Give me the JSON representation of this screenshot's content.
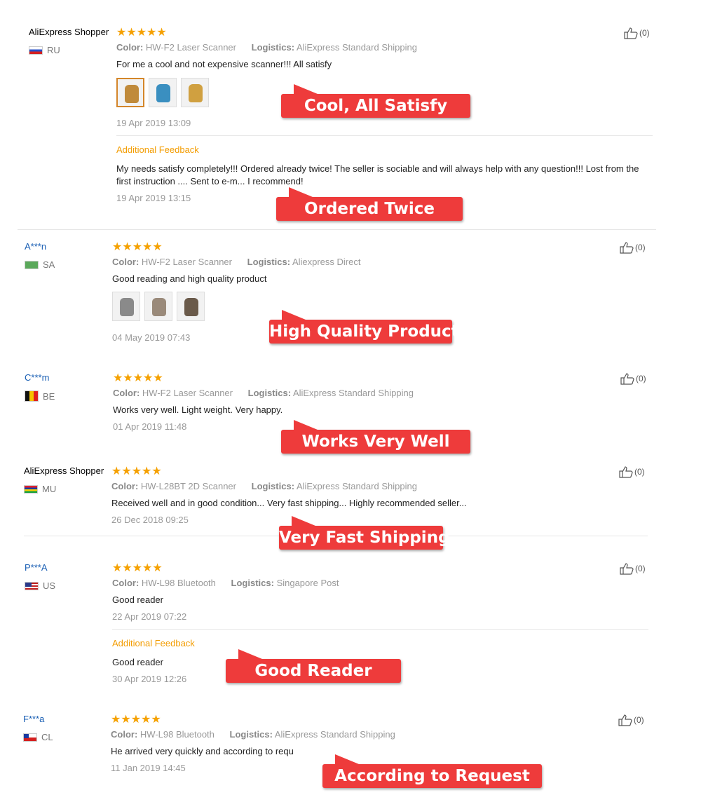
{
  "like_label": "(0)",
  "labels": {
    "color": "Color:",
    "logistics": "Logistics:",
    "additional": "Additional Feedback"
  },
  "colors": {
    "accent_orange": "#f39c00",
    "callout_red": "#ee3b3b",
    "star": "#f5a100",
    "link_blue": "#1a5fb4"
  },
  "reviews": [
    {
      "user": "AliExpress Shopper",
      "country": "RU",
      "stars": "★★★★★",
      "color": "HW-F2 Laser Scanner",
      "logistics": "AliExpress Standard Shipping",
      "text": "For me a cool and not expensive scanner!!! All satisfy",
      "date": "19 Apr 2019 13:09",
      "additional_text": "My needs satisfy completely!!! Ordered already twice! The seller is sociable and will always help with any question!!! Lost from the first instruction .... Sent to e-m... I recommend!",
      "additional_date": "19 Apr 2019 13:15",
      "callouts": [
        "Cool, All Satisfy",
        "Ordered Twice"
      ]
    },
    {
      "user": "A***n",
      "country": "SA",
      "stars": "★★★★★",
      "color": "HW-F2 Laser Scanner",
      "logistics": "Aliexpress Direct",
      "text": "Good reading and high quality product",
      "date": "04 May 2019 07:43",
      "callouts": [
        "High Quality Product"
      ]
    },
    {
      "user": "C***m",
      "country": "BE",
      "stars": "★★★★★",
      "color": "HW-F2 Laser Scanner",
      "logistics": "AliExpress Standard Shipping",
      "text": "Works very well. Light weight. Very happy.",
      "date": "01 Apr 2019 11:48",
      "callouts": [
        "Works Very Well"
      ]
    },
    {
      "user": "AliExpress Shopper",
      "country": "MU",
      "stars": "★★★★★",
      "color": "HW-L28BT 2D Scanner",
      "logistics": "AliExpress Standard Shipping",
      "text": "Received well and in good condition... Very fast shipping... Highly recommended seller...",
      "date": "26 Dec 2018 09:25",
      "callouts": [
        "Very Fast Shipping"
      ]
    },
    {
      "user": "P***A",
      "country": "US",
      "stars": "★★★★★",
      "color": "HW-L98 Bluetooth",
      "logistics": "Singapore Post",
      "text": "Good reader",
      "date": "22 Apr 2019 07:22",
      "additional_text": "Good reader",
      "additional_date": "30 Apr 2019 12:26",
      "callouts": [
        "Good Reader"
      ]
    },
    {
      "user": "F***a",
      "country": "CL",
      "stars": "★★★★★",
      "color": "HW-L98 Bluetooth",
      "logistics": "AliExpress Standard Shipping",
      "text": "He arrived very quickly and according to requ",
      "date": "11 Jan 2019 14:45",
      "callouts": [
        "According to Request"
      ]
    }
  ]
}
